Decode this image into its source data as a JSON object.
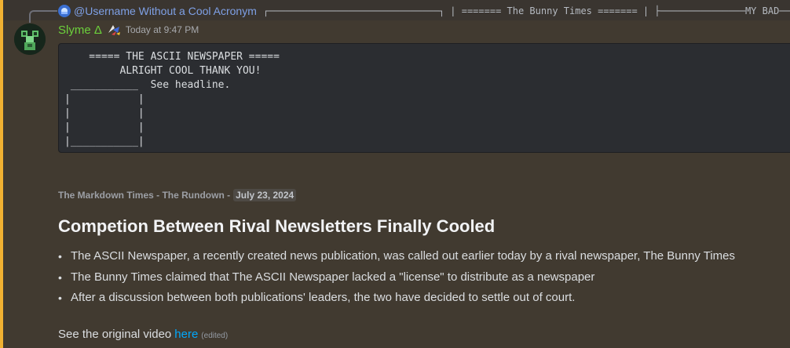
{
  "reply": {
    "username": "@Username Without a Cool Acronym",
    "preview": "┌──────────────────────────────┐ | ======= The Bunny Times ======= | ├───────────────MY BAD──"
  },
  "message": {
    "username": "Slyme Δ",
    "timestamp": "Today at 9:47 PM",
    "code": "    ===== THE ASCII NEWSPAPER =====\n         ALRIGHT COOL THANK YOU!\n ___________  See headline.\n|           |\n|           |\n|           |\n|___________|",
    "subtext_label": "The Markdown Times - The Rundown -",
    "subtext_date": "July 23, 2024",
    "headline": "Competion Between Rival Newsletters Finally Cooled",
    "bullets": [
      "The ASCII Newspaper, a recently created news publication, was called out earlier today by a rival newspaper, The Bunny Times",
      "The Bunny Times claimed that The ASCII Newspaper lacked a \"license\" to distribute as a newspaper",
      "After a discussion between both publications' leaders, the two have decided to settle out of court."
    ],
    "footer_text": "See the original video",
    "footer_link": "here",
    "edited_label": "(edited)"
  },
  "colors": {
    "mention_highlight": "#f0b132",
    "username": "#6cd03c",
    "link": "#00a8fc"
  },
  "icons": [
    "reply-avatar-icon",
    "avatar-robot-icon",
    "role-badge-icon"
  ]
}
